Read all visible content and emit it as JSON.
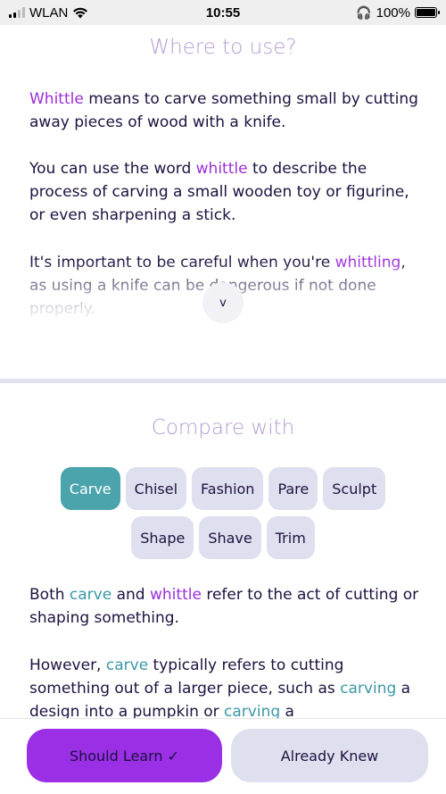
{
  "status_bar": {
    "carrier": "WLAN",
    "time": "10:55",
    "battery": "100%",
    "battery_level": 1.0
  },
  "section1": {
    "title": "Where to use?",
    "paragraphs": [
      [
        {
          "t": "Whittle",
          "hl": "purple"
        },
        {
          "t": " means to carve something small by cutting away pieces of wood with a knife."
        }
      ],
      [
        {
          "t": "You can use the word "
        },
        {
          "t": "whittle",
          "hl": "purple"
        },
        {
          "t": " to describe the process of carving a small wooden toy or figurine, or even sharpening a stick."
        }
      ],
      [
        {
          "t": "It's important to be careful when you're "
        },
        {
          "t": "whittling",
          "hl": "purple"
        },
        {
          "t": ", as using a knife can be dangerous if not done properly."
        }
      ]
    ],
    "expand_label": "v"
  },
  "section2": {
    "title": "Compare with",
    "chips_row1": [
      "Carve",
      "Chisel",
      "Fashion",
      "Pare",
      "Sculpt"
    ],
    "chips_row2": [
      "Shape",
      "Shave",
      "Trim"
    ],
    "active_chip": "Carve",
    "paragraphs": [
      [
        {
          "t": "Both "
        },
        {
          "t": "carve",
          "hl": "teal"
        },
        {
          "t": " and "
        },
        {
          "t": "whittle",
          "hl": "purple"
        },
        {
          "t": " refer to the act of cutting or shaping something."
        }
      ],
      [
        {
          "t": "However, "
        },
        {
          "t": "carve",
          "hl": "teal"
        },
        {
          "t": " typically refers to cutting something out of a larger piece, such as "
        },
        {
          "t": "carving",
          "hl": "teal"
        },
        {
          "t": " a design into a pumpkin or "
        },
        {
          "t": "carving",
          "hl": "teal"
        },
        {
          "t": " a"
        }
      ]
    ]
  },
  "bottom": {
    "should_learn": "Should Learn ✓",
    "already_knew": "Already Knew"
  },
  "colors": {
    "purple_highlight": "#9b2fd9",
    "teal_highlight": "#3a98a6",
    "primary_button": "#9a2fe6",
    "active_chip": "#4ba3ac"
  }
}
